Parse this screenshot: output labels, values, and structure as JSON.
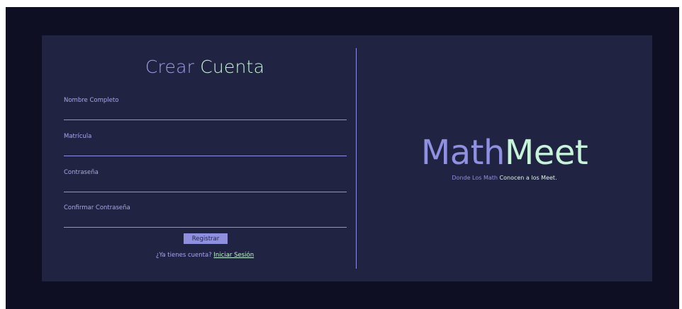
{
  "form": {
    "title_part1": "Crear",
    "title_part2": "Cuenta",
    "fields": [
      {
        "label": "Nombre Completo",
        "value": ""
      },
      {
        "label": "Matrícula",
        "value": ""
      },
      {
        "label": "Contraseña",
        "value": ""
      },
      {
        "label": "Confirmar Contraseña",
        "value": ""
      }
    ],
    "submit_label": "Registrar",
    "login_prompt": "¿Ya tienes cuenta?",
    "login_link": "Iniciar Sesión"
  },
  "brand": {
    "name_part1": "Math",
    "name_part2": "Meet",
    "tagline_part1": "Donde Los Math",
    "tagline_part2": "Conocen a los Meet."
  },
  "colors": {
    "outer_background": "#0e0f22",
    "card_background": "#212342",
    "accent_purple": "#8f90e0",
    "accent_mint": "#c6f3d9"
  }
}
